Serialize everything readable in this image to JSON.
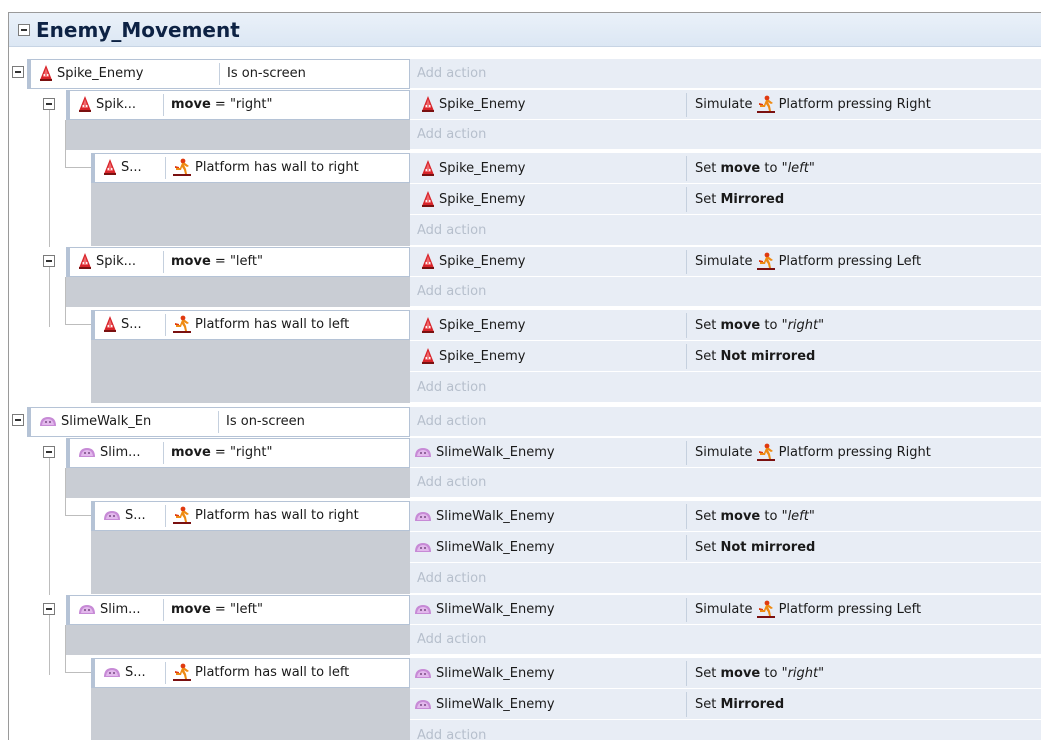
{
  "group": {
    "title": "Enemy_Movement"
  },
  "labels": {
    "add_action": "Add action",
    "is_on_screen": "Is on-screen",
    "move_var": "move",
    "simulate": "Simulate",
    "platform_pressing_right": "Platform pressing Right",
    "platform_pressing_left": "Platform pressing Left",
    "platform_wall_right": "Platform has wall to right",
    "platform_wall_left": "Platform has wall to left",
    "set": "Set",
    "to": "to",
    "set_mirrored": "Mirrored",
    "set_not_mirrored": "Not mirrored"
  },
  "objects": {
    "spike": "Spike_Enemy",
    "spike_trunc1": "Spik...",
    "spike_trunc2": "S...",
    "slime": "SlimeWalk_Enemy",
    "slime_top": "SlimeWalk_En",
    "slime_trunc1": "Slim...",
    "slime_trunc2": "S..."
  },
  "values": {
    "eq_right": " = \"right\"",
    "eq_left": " = \"left\"",
    "str_left": "\"left\"",
    "str_right": "\"right\""
  },
  "colors": {
    "header_bg": "#dce7f4",
    "action_bg": "#e8edf5",
    "sub_bg": "#c9cdd4",
    "condition_border": "#b5c3d6",
    "add_action_text": "#b6bfcc"
  },
  "icons": {
    "spike": "spike-enemy-icon",
    "slime": "slime-enemy-icon",
    "platform": "platform-behavior-icon"
  }
}
